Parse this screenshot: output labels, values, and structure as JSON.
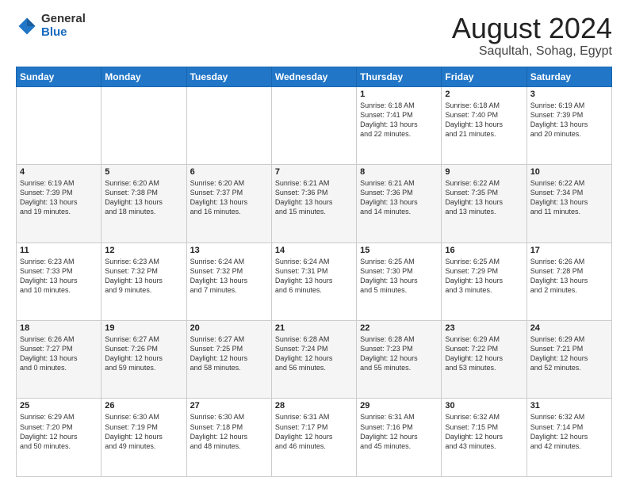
{
  "header": {
    "logo_general": "General",
    "logo_blue": "Blue",
    "title": "August 2024",
    "location": "Saqultah, Sohag, Egypt"
  },
  "weekdays": [
    "Sunday",
    "Monday",
    "Tuesday",
    "Wednesday",
    "Thursday",
    "Friday",
    "Saturday"
  ],
  "weeks": [
    [
      {
        "day": "",
        "info": ""
      },
      {
        "day": "",
        "info": ""
      },
      {
        "day": "",
        "info": ""
      },
      {
        "day": "",
        "info": ""
      },
      {
        "day": "1",
        "info": "Sunrise: 6:18 AM\nSunset: 7:41 PM\nDaylight: 13 hours\nand 22 minutes."
      },
      {
        "day": "2",
        "info": "Sunrise: 6:18 AM\nSunset: 7:40 PM\nDaylight: 13 hours\nand 21 minutes."
      },
      {
        "day": "3",
        "info": "Sunrise: 6:19 AM\nSunset: 7:39 PM\nDaylight: 13 hours\nand 20 minutes."
      }
    ],
    [
      {
        "day": "4",
        "info": "Sunrise: 6:19 AM\nSunset: 7:39 PM\nDaylight: 13 hours\nand 19 minutes."
      },
      {
        "day": "5",
        "info": "Sunrise: 6:20 AM\nSunset: 7:38 PM\nDaylight: 13 hours\nand 18 minutes."
      },
      {
        "day": "6",
        "info": "Sunrise: 6:20 AM\nSunset: 7:37 PM\nDaylight: 13 hours\nand 16 minutes."
      },
      {
        "day": "7",
        "info": "Sunrise: 6:21 AM\nSunset: 7:36 PM\nDaylight: 13 hours\nand 15 minutes."
      },
      {
        "day": "8",
        "info": "Sunrise: 6:21 AM\nSunset: 7:36 PM\nDaylight: 13 hours\nand 14 minutes."
      },
      {
        "day": "9",
        "info": "Sunrise: 6:22 AM\nSunset: 7:35 PM\nDaylight: 13 hours\nand 13 minutes."
      },
      {
        "day": "10",
        "info": "Sunrise: 6:22 AM\nSunset: 7:34 PM\nDaylight: 13 hours\nand 11 minutes."
      }
    ],
    [
      {
        "day": "11",
        "info": "Sunrise: 6:23 AM\nSunset: 7:33 PM\nDaylight: 13 hours\nand 10 minutes."
      },
      {
        "day": "12",
        "info": "Sunrise: 6:23 AM\nSunset: 7:32 PM\nDaylight: 13 hours\nand 9 minutes."
      },
      {
        "day": "13",
        "info": "Sunrise: 6:24 AM\nSunset: 7:32 PM\nDaylight: 13 hours\nand 7 minutes."
      },
      {
        "day": "14",
        "info": "Sunrise: 6:24 AM\nSunset: 7:31 PM\nDaylight: 13 hours\nand 6 minutes."
      },
      {
        "day": "15",
        "info": "Sunrise: 6:25 AM\nSunset: 7:30 PM\nDaylight: 13 hours\nand 5 minutes."
      },
      {
        "day": "16",
        "info": "Sunrise: 6:25 AM\nSunset: 7:29 PM\nDaylight: 13 hours\nand 3 minutes."
      },
      {
        "day": "17",
        "info": "Sunrise: 6:26 AM\nSunset: 7:28 PM\nDaylight: 13 hours\nand 2 minutes."
      }
    ],
    [
      {
        "day": "18",
        "info": "Sunrise: 6:26 AM\nSunset: 7:27 PM\nDaylight: 13 hours\nand 0 minutes."
      },
      {
        "day": "19",
        "info": "Sunrise: 6:27 AM\nSunset: 7:26 PM\nDaylight: 12 hours\nand 59 minutes."
      },
      {
        "day": "20",
        "info": "Sunrise: 6:27 AM\nSunset: 7:25 PM\nDaylight: 12 hours\nand 58 minutes."
      },
      {
        "day": "21",
        "info": "Sunrise: 6:28 AM\nSunset: 7:24 PM\nDaylight: 12 hours\nand 56 minutes."
      },
      {
        "day": "22",
        "info": "Sunrise: 6:28 AM\nSunset: 7:23 PM\nDaylight: 12 hours\nand 55 minutes."
      },
      {
        "day": "23",
        "info": "Sunrise: 6:29 AM\nSunset: 7:22 PM\nDaylight: 12 hours\nand 53 minutes."
      },
      {
        "day": "24",
        "info": "Sunrise: 6:29 AM\nSunset: 7:21 PM\nDaylight: 12 hours\nand 52 minutes."
      }
    ],
    [
      {
        "day": "25",
        "info": "Sunrise: 6:29 AM\nSunset: 7:20 PM\nDaylight: 12 hours\nand 50 minutes."
      },
      {
        "day": "26",
        "info": "Sunrise: 6:30 AM\nSunset: 7:19 PM\nDaylight: 12 hours\nand 49 minutes."
      },
      {
        "day": "27",
        "info": "Sunrise: 6:30 AM\nSunset: 7:18 PM\nDaylight: 12 hours\nand 48 minutes."
      },
      {
        "day": "28",
        "info": "Sunrise: 6:31 AM\nSunset: 7:17 PM\nDaylight: 12 hours\nand 46 minutes."
      },
      {
        "day": "29",
        "info": "Sunrise: 6:31 AM\nSunset: 7:16 PM\nDaylight: 12 hours\nand 45 minutes."
      },
      {
        "day": "30",
        "info": "Sunrise: 6:32 AM\nSunset: 7:15 PM\nDaylight: 12 hours\nand 43 minutes."
      },
      {
        "day": "31",
        "info": "Sunrise: 6:32 AM\nSunset: 7:14 PM\nDaylight: 12 hours\nand 42 minutes."
      }
    ]
  ]
}
